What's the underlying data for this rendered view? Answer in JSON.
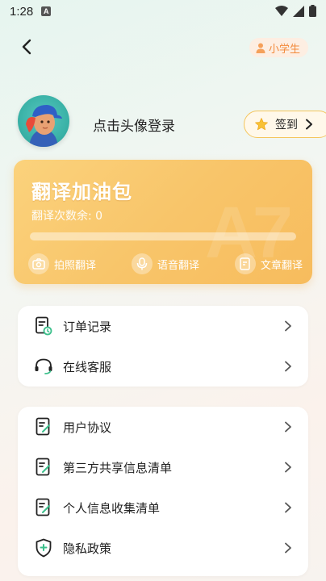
{
  "status_bar": {
    "time": "1:28",
    "badge": "A"
  },
  "header": {
    "role_label": "小学生"
  },
  "profile": {
    "login_prompt": "点击头像登录",
    "signin_label": "签到"
  },
  "fuel_pack": {
    "title": "翻译加油包",
    "remaining_label": "翻译次数余: 0",
    "progress": 0,
    "actions": [
      {
        "label": "拍照翻译",
        "icon": "camera-icon"
      },
      {
        "label": "语音翻译",
        "icon": "microphone-icon"
      },
      {
        "label": "文章翻译",
        "icon": "document-edit-icon"
      }
    ]
  },
  "menu_group_1": [
    {
      "label": "订单记录",
      "icon": "order-record-icon"
    },
    {
      "label": "在线客服",
      "icon": "headset-icon"
    }
  ],
  "menu_group_2": [
    {
      "label": "用户协议",
      "icon": "document-icon"
    },
    {
      "label": "第三方共享信息清单",
      "icon": "document-icon"
    },
    {
      "label": "个人信息收集清单",
      "icon": "document-icon"
    },
    {
      "label": "隐私政策",
      "icon": "shield-icon"
    }
  ],
  "colors": {
    "accent": "#f7bc5d",
    "icon_green": "#3cc08c",
    "text": "#222222"
  }
}
